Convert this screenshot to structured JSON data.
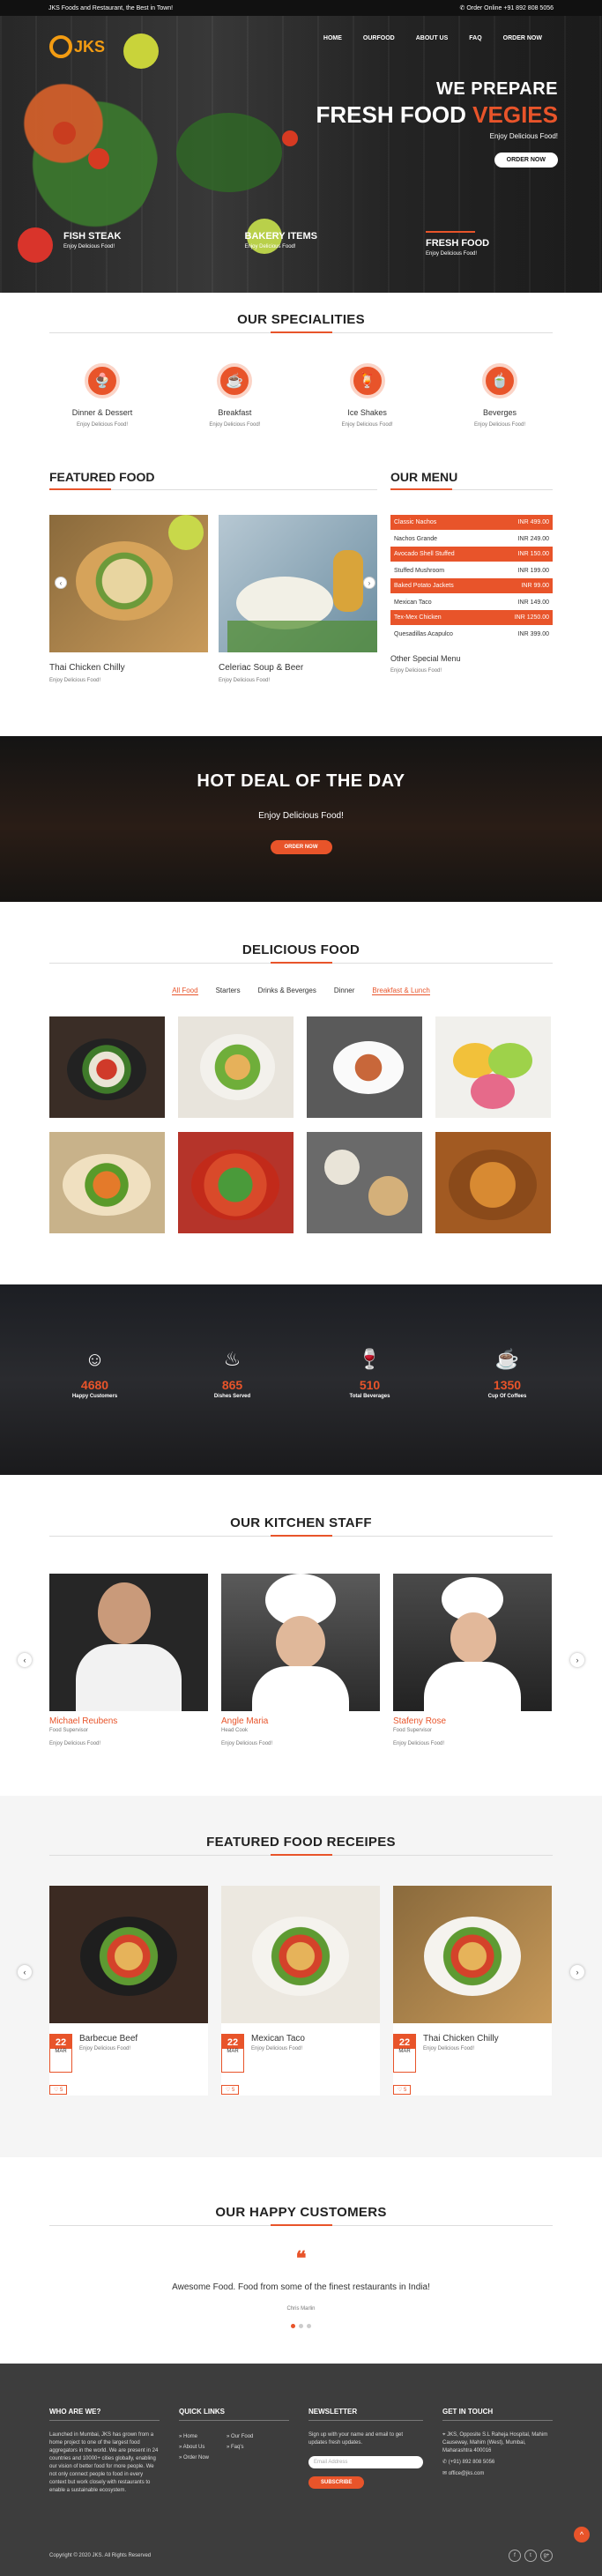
{
  "topbar": {
    "left": "JKS Foods and Restaurant, the Best in Town!",
    "right": "✆ Order Online +91 892 808 5056"
  },
  "brand": {
    "logo_text": "JKS"
  },
  "nav": [
    "HOME",
    "OURFOOD",
    "ABOUT US",
    "FAQ",
    "ORDER NOW"
  ],
  "hero": {
    "line1": "WE PREPARE",
    "line2a": "FRESH FOOD",
    "line2b": "VEGIES",
    "line3": "Enjoy Delicious Food!",
    "button": "ORDER NOW",
    "features": [
      {
        "title": "FISH STEAK",
        "sub": "Enjoy Delicious Food!"
      },
      {
        "title": "BAKERY ITEMS",
        "sub": "Enjoy Delicious Food!"
      },
      {
        "title": "FRESH FOOD",
        "sub": "Enjoy Delicious Food!"
      }
    ]
  },
  "specialities": {
    "title": "OUR SPECIALITIES",
    "items": [
      {
        "icon": "ice-cream-icon",
        "glyph": "🍨",
        "title": "Dinner & Dessert",
        "sub": "Enjoy Delicious Food!"
      },
      {
        "icon": "coffee-cup-icon",
        "glyph": "☕",
        "title": "Breakfast",
        "sub": "Enjoy Delicious Food!"
      },
      {
        "icon": "shake-glass-icon",
        "glyph": "🍹",
        "title": "Ice Shakes",
        "sub": "Enjoy Delicious Food!"
      },
      {
        "icon": "tea-cup-icon",
        "glyph": "🍵",
        "title": "Beverges",
        "sub": "Enjoy Delicious Food!"
      }
    ]
  },
  "featured_food": {
    "title": "FEATURED FOOD",
    "items": [
      {
        "title": "Thai Chicken Chilly",
        "sub": "Enjoy Delicious Food!"
      },
      {
        "title": "Celeriac Soup & Beer",
        "sub": "Enjoy Delicious Food!"
      }
    ]
  },
  "our_menu": {
    "title": "OUR MENU",
    "rows": [
      {
        "name": "Classic Nachos",
        "price": "INR 499.00",
        "highlight": true
      },
      {
        "name": "Nachos Grande",
        "price": "INR 249.00",
        "highlight": false
      },
      {
        "name": "Avocado Shell Stuffed",
        "price": "INR 150.00",
        "highlight": true
      },
      {
        "name": "Stuffed Mushroom",
        "price": "INR 199.00",
        "highlight": false
      },
      {
        "name": "Baked Potato Jackets",
        "price": "INR 99.00",
        "highlight": true
      },
      {
        "name": "Mexican Taco",
        "price": "INR 149.00",
        "highlight": false
      },
      {
        "name": "Tex-Mex Chicken",
        "price": "INR 1250.00",
        "highlight": true
      },
      {
        "name": "Quesadillas Acapulco",
        "price": "INR 399.00",
        "highlight": false
      }
    ],
    "other_title": "Other Special Menu",
    "other_sub": "Enjoy Delicious Food!"
  },
  "hot_deal": {
    "title": "HOT DEAL OF THE DAY",
    "sub": "Enjoy Delicious Food!",
    "button": "ORDER NOW"
  },
  "delicious": {
    "title": "DELICIOUS FOOD",
    "tabs": [
      {
        "label": "All Food",
        "active": true
      },
      {
        "label": "Starters",
        "active": false
      },
      {
        "label": "Drinks & Beverges",
        "active": false
      },
      {
        "label": "Dinner",
        "active": false
      },
      {
        "label": "Breakfast & Lunch",
        "active": true
      }
    ]
  },
  "stats": [
    {
      "icon": "smile-icon",
      "glyph": "☺",
      "number": "4680",
      "label": "Happy Customers"
    },
    {
      "icon": "dish-icon",
      "glyph": "♨",
      "number": "865",
      "label": "Dishes Served"
    },
    {
      "icon": "wine-glass-icon",
      "glyph": "🍷",
      "number": "510",
      "label": "Total Beverages"
    },
    {
      "icon": "coffee-icon",
      "glyph": "☕",
      "number": "1350",
      "label": "Cup Of Coffees"
    }
  ],
  "staff": {
    "title": "OUR KITCHEN STAFF",
    "members": [
      {
        "name": "Michael Reubens",
        "role": "Food Supervisor",
        "sub": "Enjoy Delicious Food!"
      },
      {
        "name": "Angle Maria",
        "role": "Head Cook",
        "sub": "Enjoy Delicious Food!"
      },
      {
        "name": "Stafeny Rose",
        "role": "Food Supervisor",
        "sub": "Enjoy Delicious Food!"
      }
    ]
  },
  "recipes": {
    "title": "FEATURED FOOD RECEIPES",
    "items": [
      {
        "day": "22",
        "month": "MAR",
        "title": "Barbecue Beef",
        "sub": "Enjoy Delicious Food!",
        "likes": "♡ 5"
      },
      {
        "day": "22",
        "month": "MAR",
        "title": "Mexican Taco",
        "sub": "Enjoy Delicious Food!",
        "likes": "♡ 5"
      },
      {
        "day": "22",
        "month": "MAR",
        "title": "Thai Chicken Chilly",
        "sub": "Enjoy Delicious Food!",
        "likes": "♡ 5"
      }
    ]
  },
  "testimonials": {
    "title": "OUR HAPPY CUSTOMERS",
    "quote": "Awesome Food. Food from some of the finest restaurants in India!",
    "author": "Chris Marlin"
  },
  "footer": {
    "about_title": "WHO ARE WE?",
    "about_text": "Launched in Mumbai, JKS has grown from a home project to one of the largest food aggregators in the world. We are present in 24 countries and 10000+ cities globally, enabling our vision of better food for more people. We not only connect people to food in every context but work closely with restaurants to enable a sustainable ecosystem.",
    "links_title": "QUICK LINKS",
    "links_col1": [
      "» Home",
      "» About Us",
      "» Order Now"
    ],
    "links_col2": [
      "» Our Food",
      "» Faq's"
    ],
    "newsletter_title": "NEWSLETTER",
    "newsletter_text": "Sign up with your name and email to get updates fresh updates.",
    "email_placeholder": "Email Address",
    "subscribe": "SUBSCRIBE",
    "contact_title": "GET IN TOUCH",
    "address": "JKS, Opposite S.L Raheja Hospital, Mahim Causeway, Mahim (West), Mumbai, Maharashtra 400016",
    "phone": "(+91) 892 808 5056",
    "email": "office@jks.com",
    "copyright": "Copyright © 2020 JKS. All Rights Reserved",
    "social": [
      "f",
      "t",
      "g+"
    ]
  },
  "colors": {
    "accent": "#e8542a",
    "dark": "#111111",
    "footer": "#3d3d3d"
  }
}
